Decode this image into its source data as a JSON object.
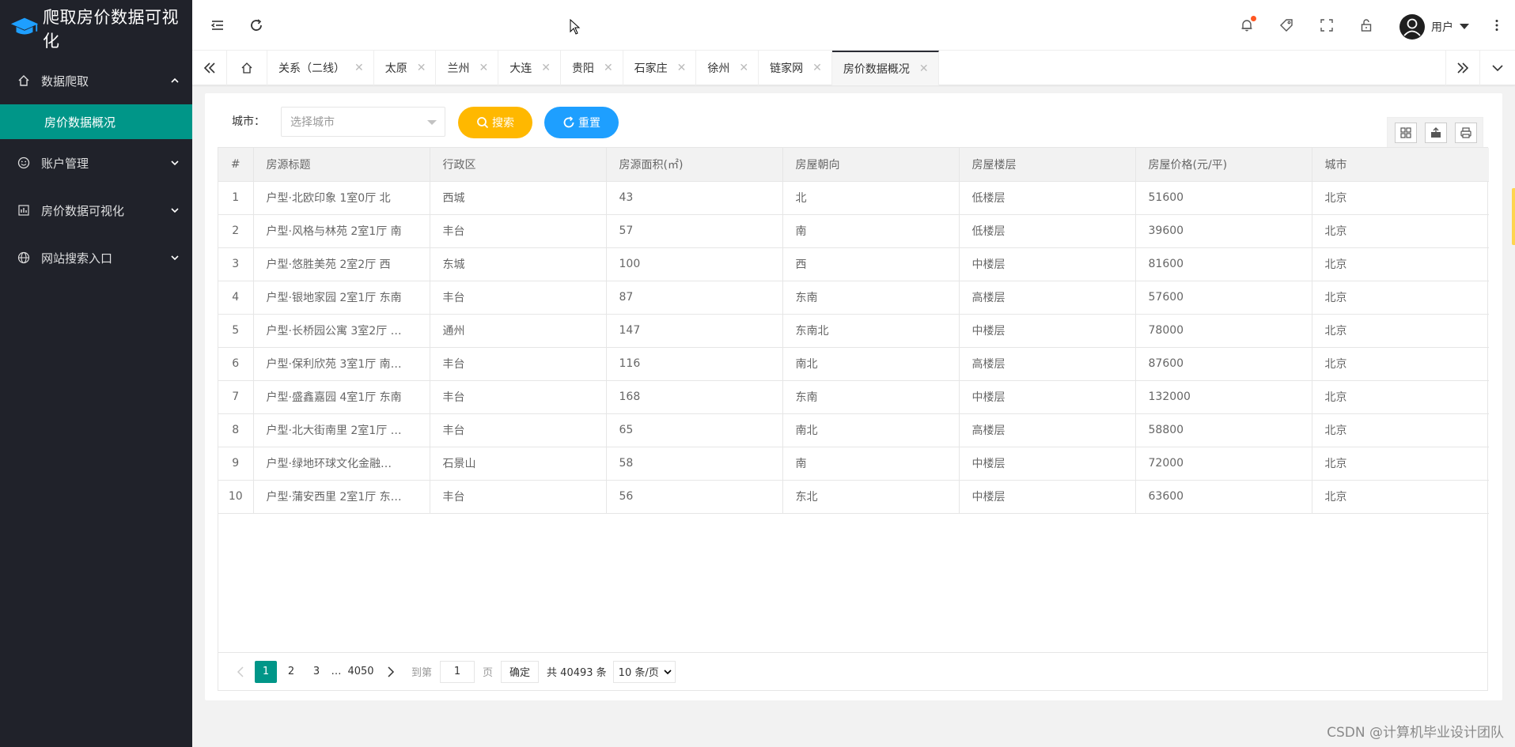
{
  "app": {
    "title": "爬取房价数据可视化"
  },
  "sidebar": {
    "items": [
      {
        "label": "数据爬取",
        "icon": "home-icon",
        "expanded": true
      },
      {
        "label": "房价数据概况",
        "sub": true
      },
      {
        "label": "账户管理",
        "icon": "smile-icon"
      },
      {
        "label": "房价数据可视化",
        "icon": "chart-icon"
      },
      {
        "label": "网站搜索入口",
        "icon": "globe-icon"
      }
    ]
  },
  "header": {
    "user_label": "用户",
    "icons": [
      "menu-collapse-icon",
      "refresh-icon",
      "bell-icon",
      "tag-icon",
      "fullscreen-icon",
      "lock-icon",
      "more-icon"
    ]
  },
  "tabs": [
    {
      "label": "关系（二线）"
    },
    {
      "label": "太原"
    },
    {
      "label": "兰州"
    },
    {
      "label": "大连"
    },
    {
      "label": "贵阳"
    },
    {
      "label": "石家庄"
    },
    {
      "label": "徐州"
    },
    {
      "label": "链家网"
    },
    {
      "label": "房价数据概况",
      "active": true
    }
  ],
  "filter": {
    "city_label": "城市：",
    "city_placeholder": "选择城市",
    "search_label": "搜索",
    "reset_label": "重置"
  },
  "table": {
    "columns": [
      "#",
      "房源标题",
      "行政区",
      "房源面积(㎡)",
      "房屋朝向",
      "房屋楼层",
      "房屋价格(元/平)",
      "城市"
    ],
    "rows": [
      [
        "1",
        "户型·北欧印象 1室0厅 北",
        "西城",
        "43",
        "北",
        "低楼层",
        "51600",
        "北京"
      ],
      [
        "2",
        "户型·风格与林苑 2室1厅 南",
        "丰台",
        "57",
        "南",
        "低楼层",
        "39600",
        "北京"
      ],
      [
        "3",
        "户型·悠胜美苑 2室2厅 西",
        "东城",
        "100",
        "西",
        "中楼层",
        "81600",
        "北京"
      ],
      [
        "4",
        "户型·银地家园 2室1厅 东南",
        "丰台",
        "87",
        "东南",
        "高楼层",
        "57600",
        "北京"
      ],
      [
        "5",
        "户型·长桥园公寓 3室2厅 …",
        "通州",
        "147",
        "东南北",
        "中楼层",
        "78000",
        "北京"
      ],
      [
        "6",
        "户型·保利欣苑 3室1厅 南…",
        "丰台",
        "116",
        "南北",
        "高楼层",
        "87600",
        "北京"
      ],
      [
        "7",
        "户型·盛鑫嘉园 4室1厅 东南",
        "丰台",
        "168",
        "东南",
        "中楼层",
        "132000",
        "北京"
      ],
      [
        "8",
        "户型·北大街南里 2室1厅 …",
        "丰台",
        "65",
        "南北",
        "高楼层",
        "58800",
        "北京"
      ],
      [
        "9",
        "户型·绿地环球文化金融…",
        "石景山",
        "58",
        "南",
        "中楼层",
        "72000",
        "北京"
      ],
      [
        "10",
        "户型·蒲安西里 2室1厅 东…",
        "丰台",
        "56",
        "东北",
        "中楼层",
        "63600",
        "北京"
      ]
    ]
  },
  "pager": {
    "pages": [
      "1",
      "2",
      "3",
      "…",
      "4050"
    ],
    "goto_label": "到第",
    "goto_value": "1",
    "page_unit": "页",
    "confirm_label": "确定",
    "total_label": "共 40493 条",
    "page_size": "10 条/页"
  },
  "watermark": "CSDN @计算机毕业设计团队",
  "colors": {
    "sidebar_bg": "#20222a",
    "accent": "#009688",
    "search_btn": "#ffb800",
    "reset_btn": "#1e9fff"
  }
}
